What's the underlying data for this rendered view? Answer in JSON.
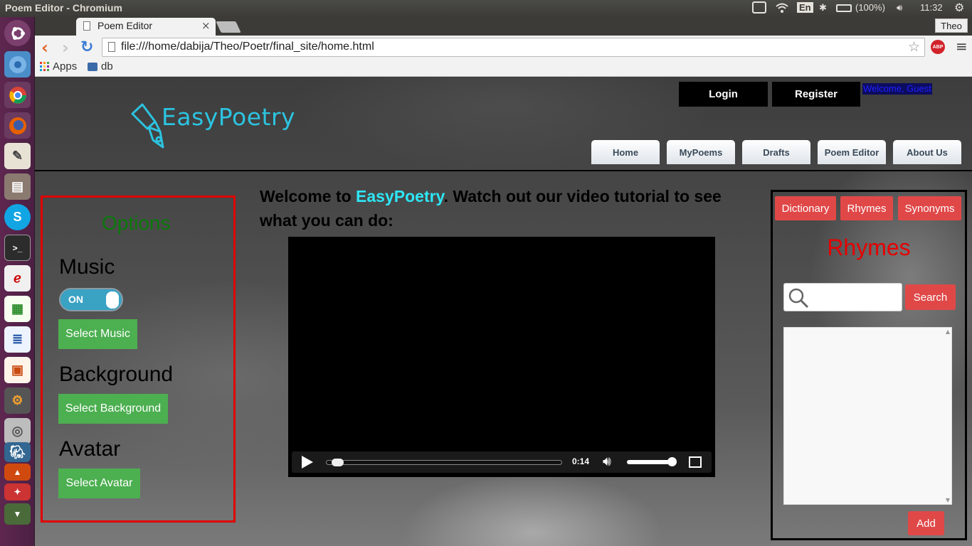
{
  "os": {
    "window_title": "Poem Editor - Chromium",
    "keyboard_layout": "En",
    "battery": "(100%)",
    "clock": "11:32"
  },
  "launcher": {
    "icons": [
      "ubuntu-dash-icon",
      "chromium-icon",
      "chrome-icon",
      "firefox-icon",
      "text-editor-icon",
      "files-icon",
      "skype-icon",
      "terminal-icon",
      "document-viewer-icon",
      "spreadsheet-icon",
      "writer-icon",
      "impress-icon",
      "settings-icon",
      "database-icon",
      "pgadmin-icon",
      "app-icon-1",
      "app-icon-2",
      "app-icon-3"
    ]
  },
  "browser": {
    "tab_title": "Poem Editor",
    "tab_close": "×",
    "profile_name": "Theo",
    "url": "file:///home/dabija/Theo/Poetr/final_site/home.html",
    "adblock_label": "ABP",
    "bookmarks": [
      "Apps",
      "db"
    ]
  },
  "site": {
    "logo_text": "EasyPoetry",
    "login_label": "Login",
    "register_label": "Register",
    "welcome_text": "Welcome, Guest",
    "nav": [
      "Home",
      "MyPoems",
      "Drafts",
      "Poem Editor",
      "About Us"
    ],
    "intro_before": "Welcome to ",
    "intro_brand": "EasyPoetry",
    "intro_after": ". Watch out our video tutorial to see what you can do:",
    "brand_color": "#2ee6f5"
  },
  "options": {
    "title": "Options",
    "music_heading": "Music",
    "toggle_label": "ON",
    "toggle_on": true,
    "select_music": "Select Music",
    "background_heading": "Background",
    "select_background": "Select Background",
    "avatar_heading": "Avatar",
    "select_avatar": "Select Avatar"
  },
  "video": {
    "time": "0:14",
    "progress": 0.02,
    "volume": 0.9
  },
  "tools": {
    "tabs": [
      "Dictionary",
      "Rhymes",
      "Synonyms"
    ],
    "title": "Rhymes",
    "search_value": "",
    "search_button": "Search",
    "add_button": "Add",
    "accent": "#e04848"
  }
}
